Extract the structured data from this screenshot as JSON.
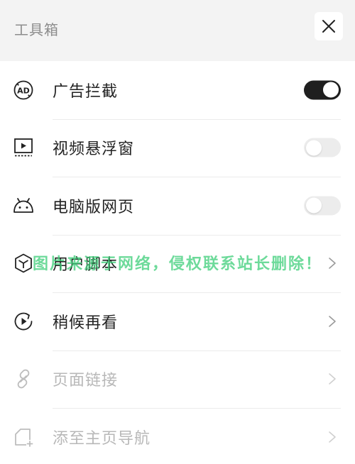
{
  "header": {
    "title": "工具箱",
    "close_icon": "close-icon"
  },
  "menu": {
    "items": [
      {
        "label": "广告拦截",
        "icon": "ad-block-icon",
        "control": "toggle",
        "on": true
      },
      {
        "label": "视频悬浮窗",
        "icon": "video-float-icon",
        "control": "toggle",
        "on": false
      },
      {
        "label": "电脑版网页",
        "icon": "android-icon",
        "control": "toggle",
        "on": false
      },
      {
        "label": "用户脚本",
        "icon": "cube-icon",
        "control": "chevron"
      },
      {
        "label": "稍候再看",
        "icon": "watch-later-icon",
        "control": "chevron"
      },
      {
        "label": "页面链接",
        "icon": "link-icon",
        "control": "chevron",
        "disabled": true
      },
      {
        "label": "添至主页导航",
        "icon": "add-home-icon",
        "control": "chevron",
        "disabled": true
      }
    ]
  },
  "watermark": "图片来源于网络，侵权联系站长删除！",
  "colors": {
    "header_bg": "#f3f3f3",
    "toggle_on": "#1f1f1f",
    "toggle_off": "#ececec",
    "text": "#222222",
    "disabled_text": "#b8b8b8",
    "watermark": "#3ccd78"
  }
}
